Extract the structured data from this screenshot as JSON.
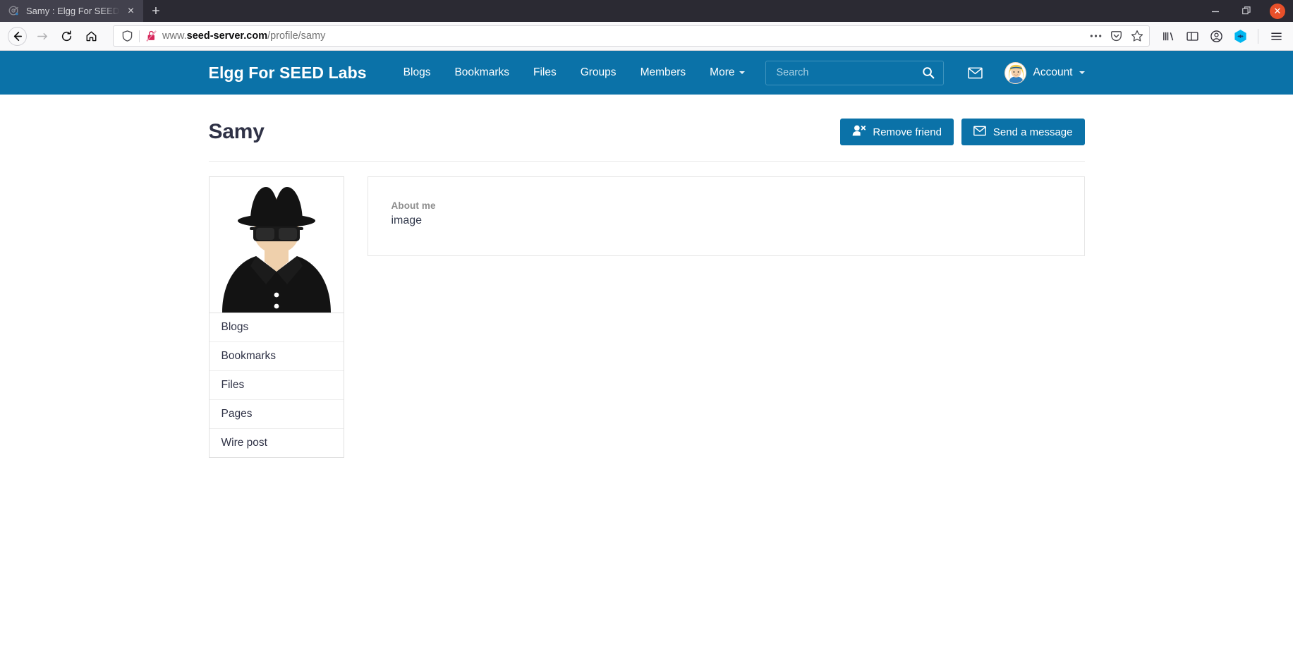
{
  "browser": {
    "tab": {
      "title": "Samy : Elgg For SEED Labs",
      "favicon_name": "elgg-favicon",
      "close_label": "×"
    },
    "newtab_label": "+",
    "window_controls": {
      "minimize": "–",
      "restore": "❐",
      "close": "✕"
    },
    "toolbar": {
      "back_label": "←",
      "forward_label": "→",
      "reload_label": "↻",
      "home_label": "⌂"
    },
    "url": {
      "prefix": "www.",
      "domain": "seed-server.com",
      "path": "/profile/samy",
      "full": "www.seed-server.com/profile/samy"
    },
    "url_actions": {
      "page_actions": "⋯",
      "pocket": "pocket-icon",
      "bookmark": "star-icon"
    },
    "right_icons": [
      "library-icon",
      "sidebar-icon",
      "account-circle-icon",
      "extension-icon",
      "hamburger-menu-icon"
    ],
    "accent": "#0b72a8",
    "close_button_color": "#e8502a"
  },
  "site": {
    "brand": "Elgg For SEED Labs",
    "nav": [
      {
        "label": "Blogs",
        "caret": false
      },
      {
        "label": "Bookmarks",
        "caret": false
      },
      {
        "label": "Files",
        "caret": false
      },
      {
        "label": "Groups",
        "caret": false
      },
      {
        "label": "Members",
        "caret": false
      },
      {
        "label": "More",
        "caret": true
      }
    ],
    "search": {
      "placeholder": "Search",
      "value": "",
      "button_icon": "search-icon"
    },
    "messages_icon": "envelope-icon",
    "account": {
      "label": "Account",
      "avatar_name": "alice-avatar",
      "caret": true
    }
  },
  "profile": {
    "title": "Samy",
    "avatar_name": "samy-anonymous-avatar",
    "actions": [
      {
        "label": "Remove friend",
        "icon": "user-remove-icon"
      },
      {
        "label": "Send a message",
        "icon": "envelope-icon"
      }
    ],
    "menu": [
      {
        "label": "Blogs"
      },
      {
        "label": "Bookmarks"
      },
      {
        "label": "Files"
      },
      {
        "label": "Pages"
      },
      {
        "label": "Wire post"
      }
    ],
    "about": {
      "label": "About me",
      "value": "image"
    }
  }
}
